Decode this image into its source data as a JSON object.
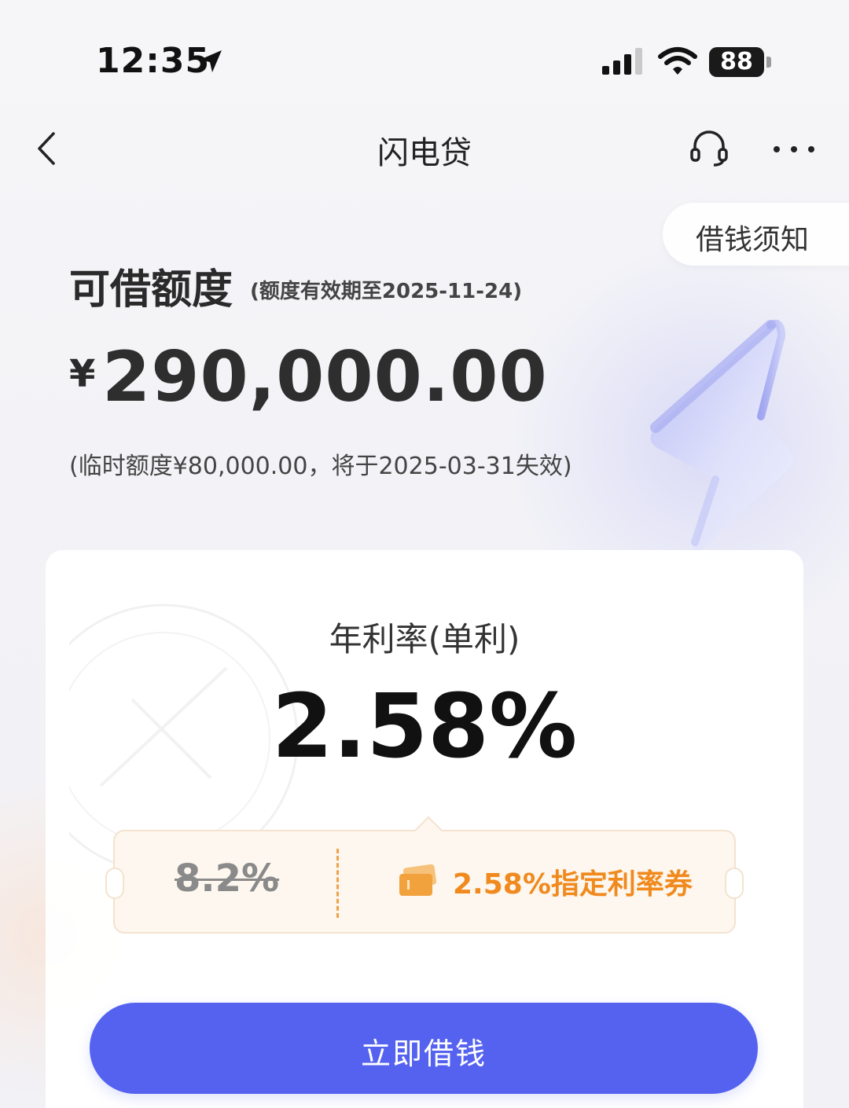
{
  "status_bar": {
    "time": "12:35",
    "battery_level": "88"
  },
  "nav": {
    "title": "闪电贷"
  },
  "notice": {
    "label": "借钱须知"
  },
  "credit": {
    "label": "可借额度",
    "validity": "(额度有效期至2025-11-24)",
    "currency_symbol": "¥",
    "amount": "290,000.00",
    "temporary_note": "(临时额度¥80,000.00，将于2025-03-31失效)"
  },
  "rate": {
    "label": "年利率(单利)",
    "value": "2.58%"
  },
  "coupon": {
    "original_rate": "8.2%",
    "text": "2.58%指定利率券"
  },
  "actions": {
    "borrow_label": "立即借钱"
  },
  "colors": {
    "primary_button": "#5562f0",
    "coupon_accent": "#f08a1e",
    "coupon_bg": "#fdf7ef"
  }
}
